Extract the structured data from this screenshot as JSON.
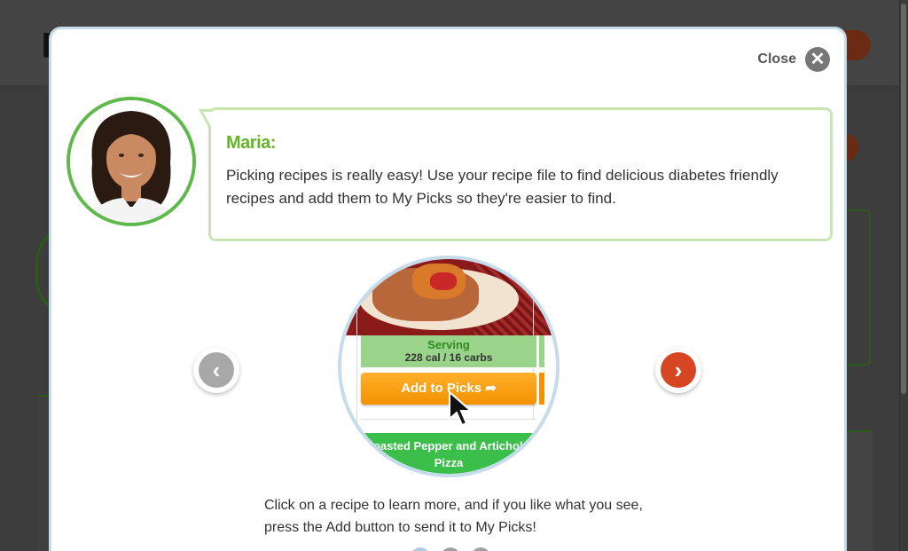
{
  "modal": {
    "close_label": "Close",
    "close_icon": "close-icon",
    "speaker_name": "Maria:",
    "speech_text": "Picking recipes is really easy! Use your recipe file to find delicious diabetes friendly recipes and add them to My Picks so they're easier to find.",
    "caption": "Click on a recipe to learn more, and if you like what you see, press the Add button to send it to My Picks!",
    "pagination": {
      "total": 3,
      "active": 1
    }
  },
  "demo": {
    "serving_title": "Serving",
    "serving_info": "228 cal / 16 carbs",
    "add_button_label": "Add to Picks",
    "next_recipe_title": "Roasted Pepper and Artichoke Pizza"
  },
  "colors": {
    "accent_green": "#64b52a",
    "add_orange": "#f39100",
    "next_red": "#d64623",
    "border_blue": "#c3dcea"
  }
}
